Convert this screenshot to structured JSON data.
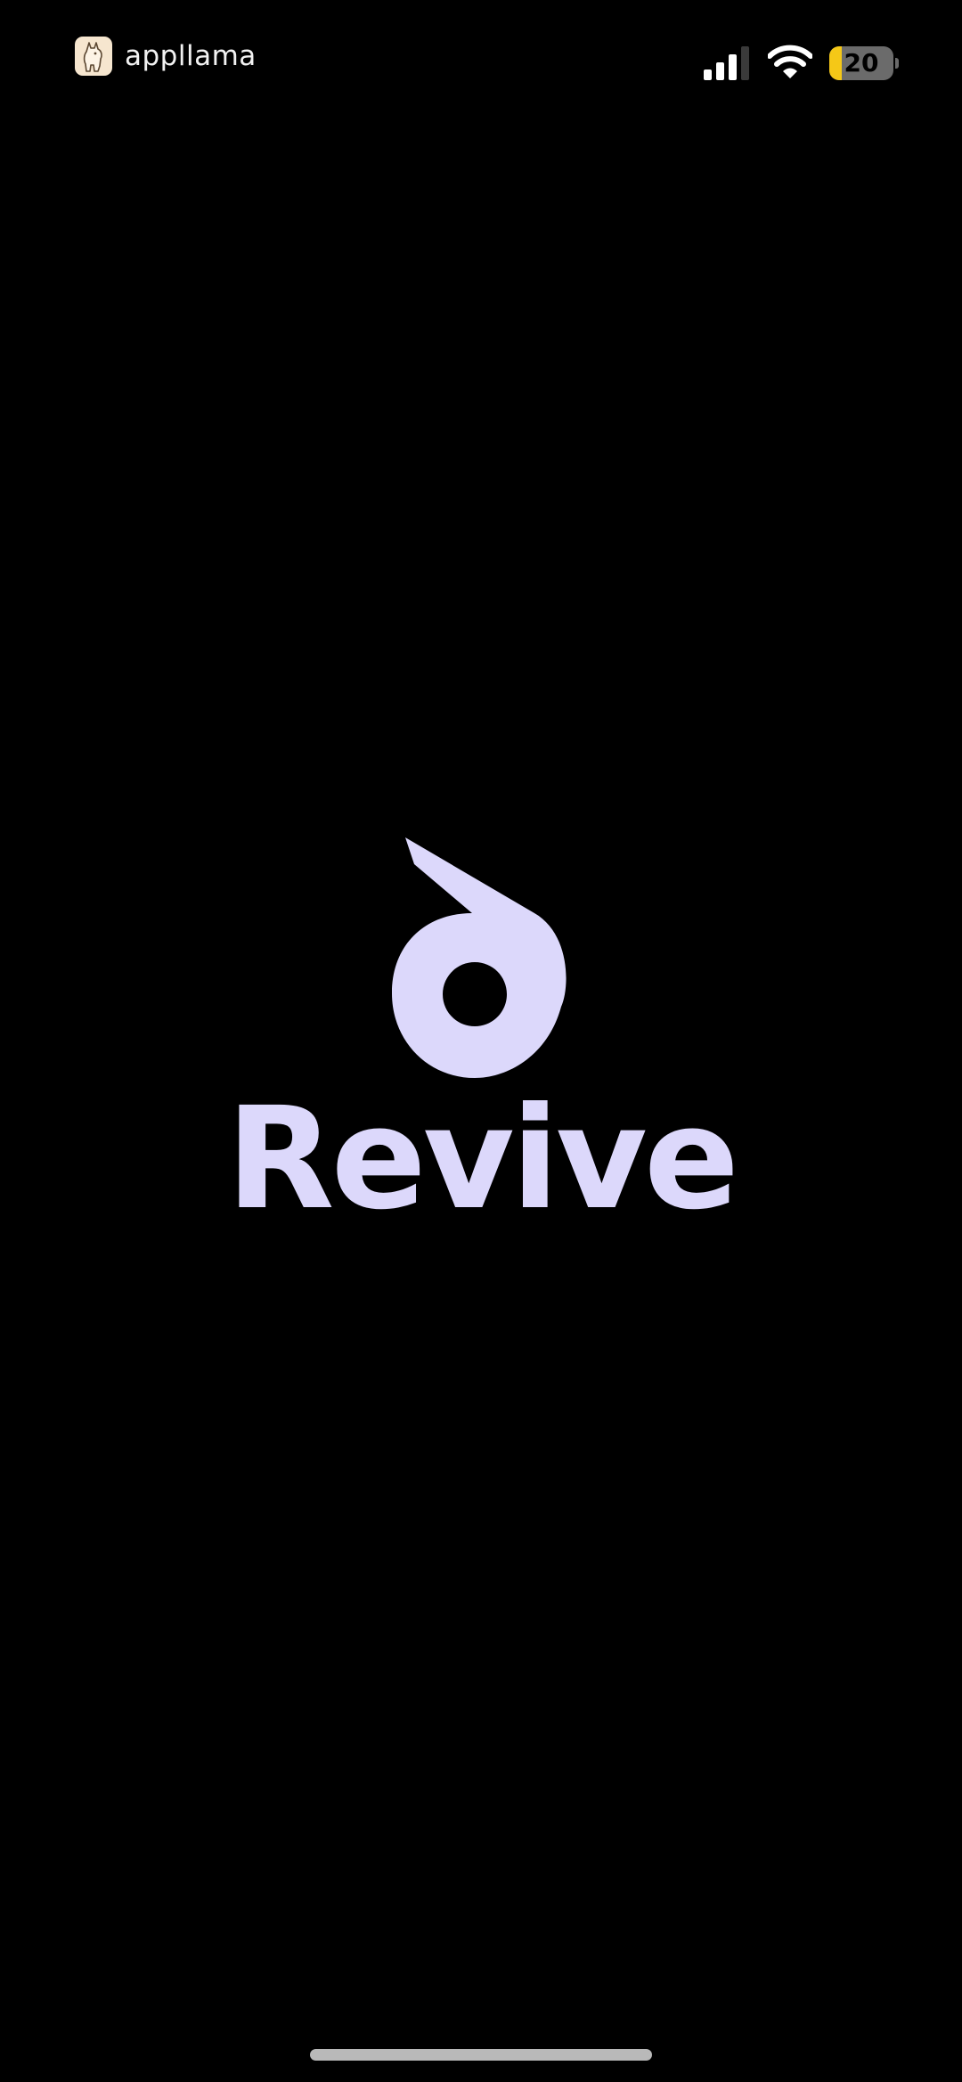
{
  "status_bar": {
    "watermark": "appllama",
    "battery_level": "20",
    "battery_fraction": 0.2,
    "colors": {
      "battery_fill": "#f5c817",
      "battery_body": "#6b6b6b"
    },
    "icons": [
      "llama-icon",
      "cellular-signal-icon",
      "wifi-icon",
      "battery-icon"
    ]
  },
  "splash": {
    "app_name": "Revive",
    "logo_icon": "revive-drop-icon",
    "colors": {
      "brand": "#dcd8fb",
      "background": "#000000"
    }
  }
}
